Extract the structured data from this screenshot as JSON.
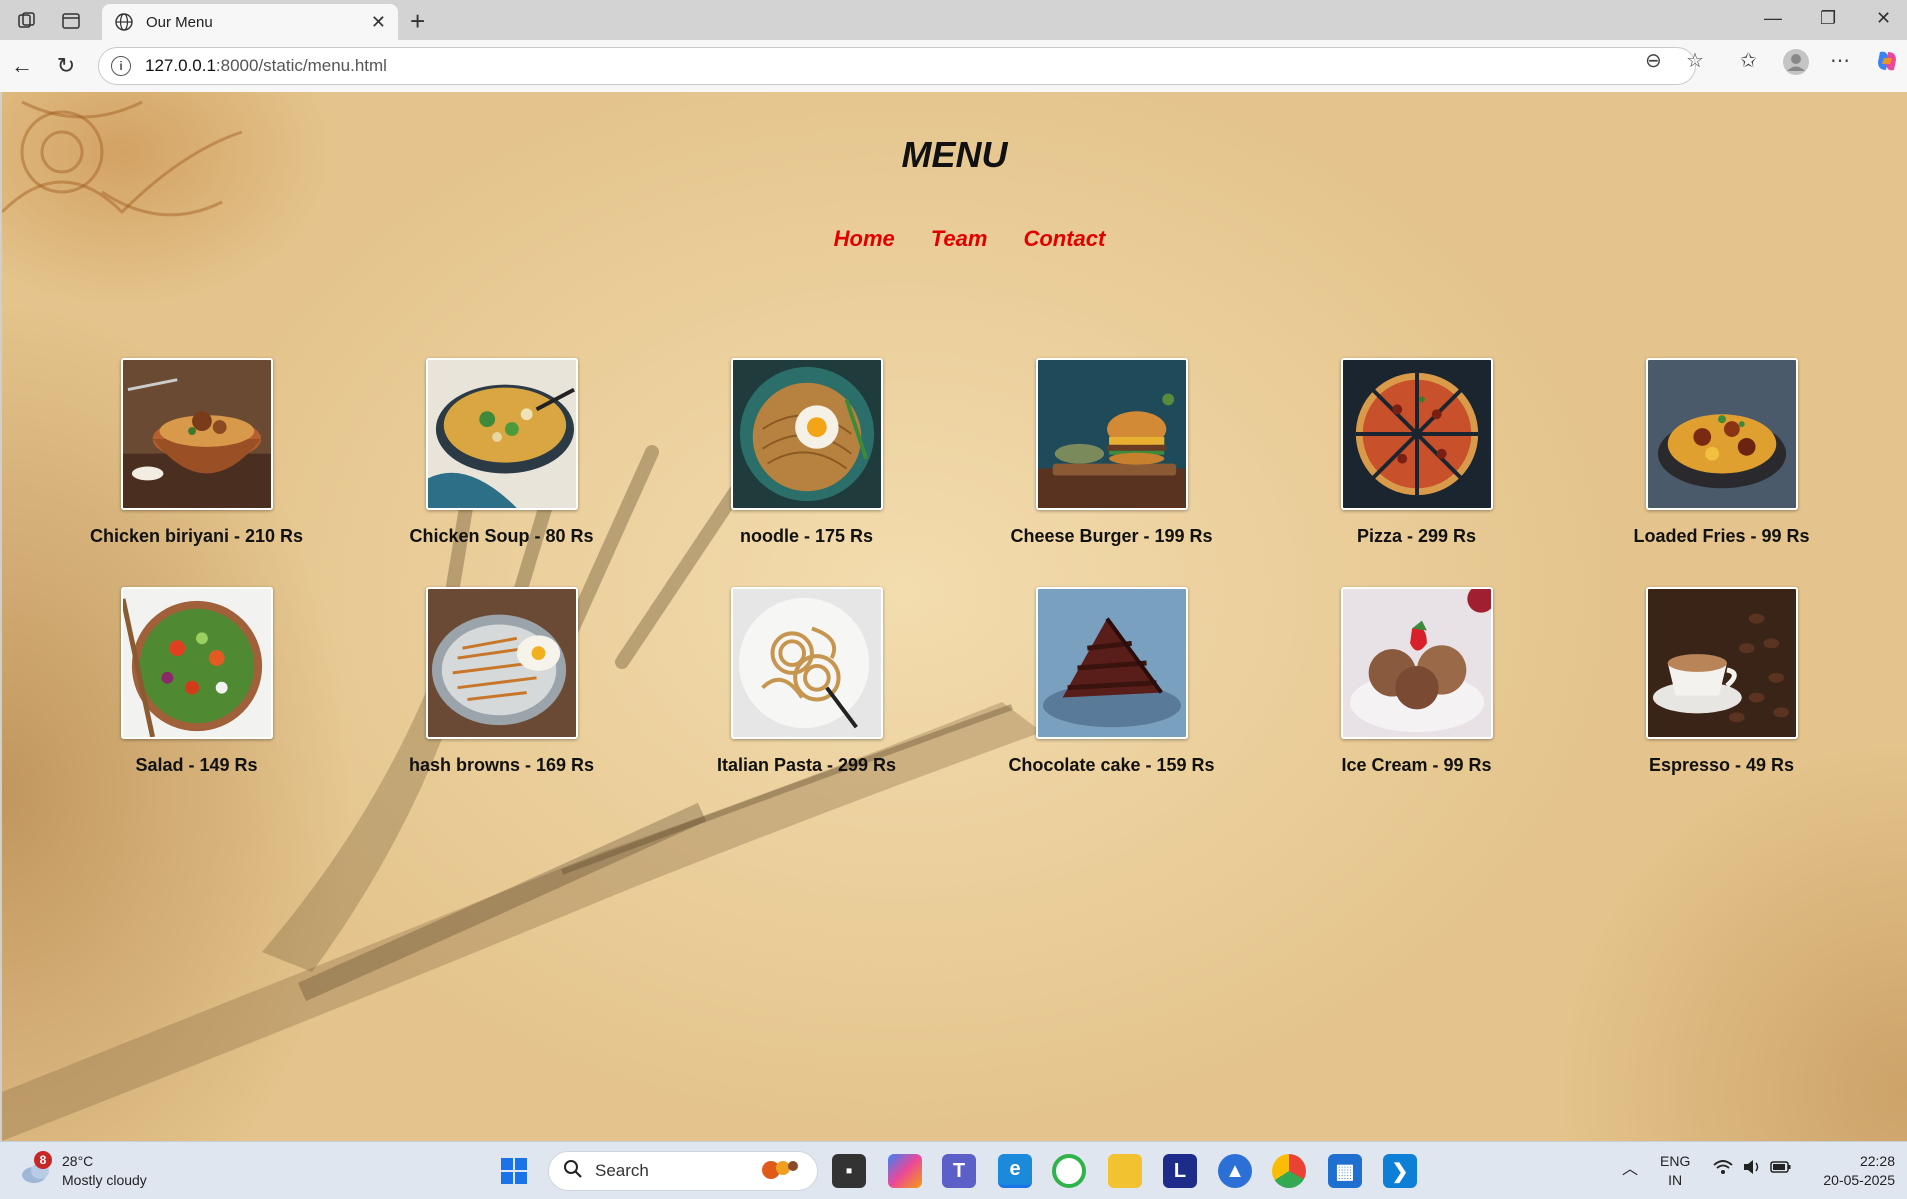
{
  "browser": {
    "tab_title": "Our Menu",
    "url_host": "127.0.0.1",
    "url_path": ":8000/static/menu.html"
  },
  "page": {
    "title": "MENU",
    "nav": [
      {
        "label": "Home"
      },
      {
        "label": "Team"
      },
      {
        "label": "Contact"
      }
    ],
    "items": [
      {
        "label": "Chicken biriyani - 210 Rs",
        "icon": "biriyani-image"
      },
      {
        "label": "Chicken Soup - 80 Rs",
        "icon": "soup-image"
      },
      {
        "label": "noodle - 175 Rs",
        "icon": "noodle-image"
      },
      {
        "label": "Cheese Burger - 199 Rs",
        "icon": "burger-image"
      },
      {
        "label": "Pizza - 299 Rs",
        "icon": "pizza-image"
      },
      {
        "label": "Loaded Fries - 99 Rs",
        "icon": "fries-image"
      },
      {
        "label": "Salad - 149 Rs",
        "icon": "salad-image"
      },
      {
        "label": "hash browns - 169 Rs",
        "icon": "hashbrowns-image"
      },
      {
        "label": "Italian Pasta - 299 Rs",
        "icon": "pasta-image"
      },
      {
        "label": "Chocolate cake - 159 Rs",
        "icon": "cake-image"
      },
      {
        "label": "Ice Cream - 99 Rs",
        "icon": "icecream-image"
      },
      {
        "label": "Espresso - 49 Rs",
        "icon": "espresso-image"
      }
    ]
  },
  "taskbar": {
    "weather_badge": "8",
    "temperature": "28°C",
    "condition": "Mostly cloudy",
    "search_label": "Search",
    "lang_top": "ENG",
    "lang_bottom": "IN",
    "time": "22:28",
    "date": "20-05-2025"
  },
  "colors": {
    "nav_link": "#e10000",
    "title": "#111111"
  }
}
